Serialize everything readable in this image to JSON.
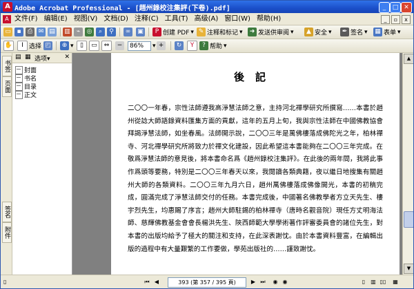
{
  "window": {
    "title": "Adobe Acrobat Professional - [趙州錄校注集評(下卷).pdf]",
    "app_icon": "acrobat-icon"
  },
  "menu": {
    "items": [
      "文件(F)",
      "编辑(E)",
      "视图(V)",
      "文档(D)",
      "注释(C)",
      "工具(T)",
      "高级(A)",
      "窗口(W)",
      "帮助(H)"
    ]
  },
  "toolbar1": {
    "labels": {
      "create_pdf": "创建 PDF",
      "comment": "注释和标记",
      "send_review": "发送供审阅",
      "secure": "安全",
      "sign": "签名",
      "forms": "表单"
    }
  },
  "toolbar2": {
    "select_label": "选择",
    "zoom_value": "86%",
    "help_label": "帮助"
  },
  "nav": {
    "options_label": "选项",
    "tabs": [
      "书签",
      "页面",
      "签名",
      "附件"
    ],
    "bookmarks": [
      "封面",
      "书名",
      "目录",
      "正文"
    ]
  },
  "document": {
    "heading": "後記",
    "body": "二〇〇一年春，宗性法師遵我高淨慧法師之意，主持河北禪學研究所撰寫……本書於趙州從諗大師語錄資料匯集方面的貢獻，這年的五月上旬，我與宗性法師在中國佛教協會拜謁淨慧法師，如坐春風。法師開示說，二〇〇三年是萬佛樓落成佛陀光之年，柏林禪寺、河北禪學研究所將致力於禪文化建設，因此希望這本書能夠在二〇〇三年完成。在敬爲淨慧法師的意見後，將本書命名爲《趙州錄校注集評》。在此後的兩年間，我將此事作爲頭等要務，特別是二〇〇三年春天以來，我閱讀各類典籍，夜以繼日地搜集有關趙州大師的各類資料。二〇〇三年九月六日，趙州萬佛樓落成佛像開光，本書的初稿完成，圓滿完成了淨慧法師交付的任務。本書完成後，中國著名佛教學者方立天先生、樓宇烈先生，均惠賜了序言；趙州大師駐錫的柏林禪寺（唐時名觀音院）現任方丈明海法師、慈輝佛教基金會會長楊洪先生、陝西師範大學學術著作評審委員會的諸位先生，對本書的出版均給予了極大的關注和支持，在此深表謝忱。由於本書資料豐富，在編輯出版的過程中有大量艱繁的工作要做，學苑出版社的……謹致謝忱。"
  },
  "statusbar": {
    "page_display": "393 (第 357 / 395 頁)"
  },
  "colors": {
    "titlebar": "#2f71e8",
    "chrome": "#ece9d8",
    "doc_background": "#808080",
    "page": "#ffffff"
  }
}
